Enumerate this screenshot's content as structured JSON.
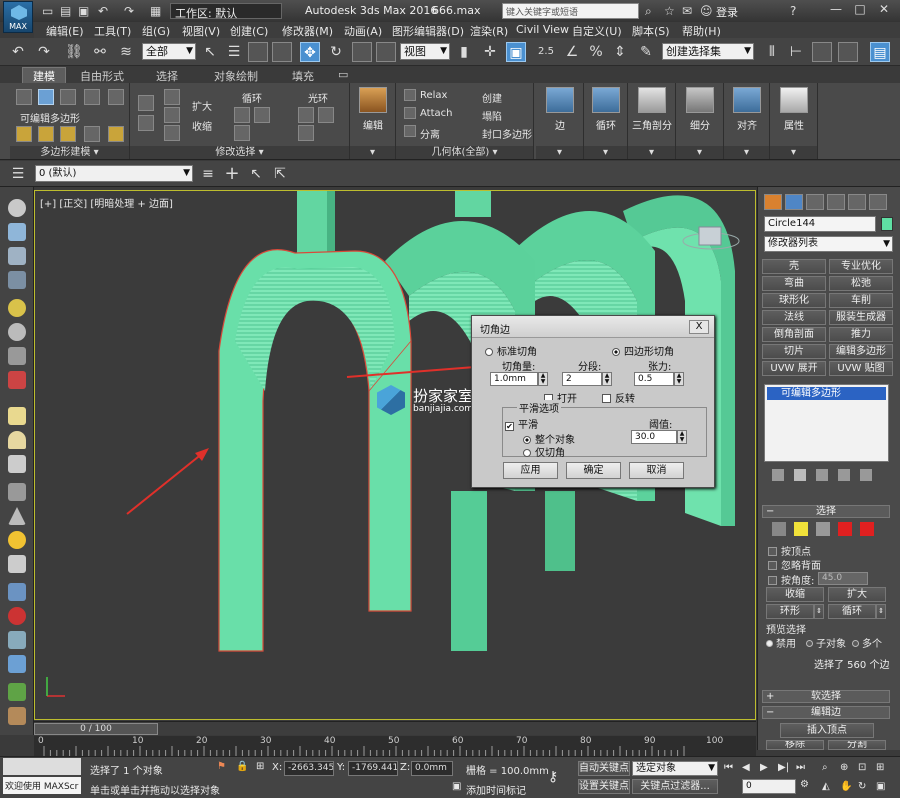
{
  "titlebar": {
    "logo_text": "MAX",
    "workspace": "工作区: 默认",
    "app_title": "Autodesk 3ds Max 2016",
    "file_title": "666.max",
    "search_placeholder": "键入关键字或短语",
    "login": "登录"
  },
  "menu": [
    "编辑(E)",
    "工具(T)",
    "组(G)",
    "视图(V)",
    "创建(C)",
    "修改器(M)",
    "动画(A)",
    "图形编辑器(D)",
    "渲染(R)",
    "Civil View",
    "自定义(U)",
    "脚本(S)",
    "帮助(H)"
  ],
  "toolbar": {
    "filter": "全部",
    "view": "视图",
    "snap_angle": "2.5",
    "snap_percent": "%",
    "selection_set": "创建选择集"
  },
  "ribbon": {
    "tabs": [
      "建模",
      "自由形式",
      "选择",
      "对象绘制",
      "填充"
    ],
    "selected_tab": "建模",
    "panel_poly": "可编辑多边形",
    "panel_poly_footer": "多边形建模",
    "grow": "扩大",
    "shrink": "收缩",
    "loop": "循环",
    "ring": "光环",
    "modify_sel_footer": "修改选择",
    "edit": "编辑",
    "relax": "Relax",
    "create": "创建",
    "attach": "Attach",
    "collapse": "塌陷",
    "detach": "分离",
    "cap": "封口多边形",
    "geometry_footer": "几何体(全部)",
    "big_buttons": [
      "边",
      "循环",
      "三角剖分",
      "细分",
      "对齐",
      "属性"
    ]
  },
  "layer": {
    "current": "0 (默认)"
  },
  "viewport": {
    "label": "[+] [正交] [明暗处理 + 边面]"
  },
  "chamfer_dialog": {
    "title": "切角边",
    "close": "X",
    "standard_chamfer": "标准切角",
    "quad_chamfer": "四边形切角",
    "amount_label": "切角量:",
    "segments_label": "分段:",
    "tension_label": "张力:",
    "amount": "1.0mm",
    "segments": "2",
    "tension": "0.5",
    "open": "打开",
    "invert": "反转",
    "smooth_group_label": "平滑选项",
    "smooth": "平滑",
    "threshold_label": "阈值:",
    "threshold": "30.0",
    "whole_object": "整个对象",
    "chamfers_only": "仅切角",
    "apply": "应用",
    "ok": "确定",
    "cancel": "取消"
  },
  "watermark": {
    "name": "扮家家室内设计",
    "url": "banjiajia.com"
  },
  "command_panel": {
    "object_name": "Circle144",
    "object_color": "#5fe0a4",
    "modifier_list": "修改器列表",
    "modifier_buttons": [
      "壳",
      "专业优化",
      "弯曲",
      "松弛",
      "球形化",
      "车削",
      "法线",
      "服装生成器",
      "倒角剖面",
      "推力",
      "切片",
      "编辑多边形",
      "UVW 展开",
      "UVW 贴图"
    ],
    "stack_item": "可编辑多边形",
    "selection_rollout": "选择",
    "by_vertex": "按顶点",
    "ignore_backfacing": "忽略背面",
    "by_angle": "按角度:",
    "angle_value": "45.0",
    "shrink": "收缩",
    "grow": "扩大",
    "ring": "环形",
    "loop": "循环",
    "preview_label": "预览选择",
    "preview_disabled": "禁用",
    "preview_subobject": "子对象",
    "preview_multi": "多个",
    "selected_count": "选择了 560 个边",
    "soft_selection": "软选择",
    "edit_edges": "编辑边",
    "insert_vertex": "插入顶点",
    "remove": "移除",
    "split": "分割"
  },
  "timeline": {
    "frame": "0 / 100",
    "ticks": [
      "0",
      "10",
      "20",
      "30",
      "40",
      "50",
      "60",
      "70",
      "80",
      "90",
      "100"
    ]
  },
  "status": {
    "welcome": "欢迎使用 MAXScr",
    "selected": "选择了 1 个对象",
    "hint": "单击或单击并拖动以选择对象",
    "x_label": "X:",
    "x": "-2663.345",
    "y_label": "Y:",
    "y": "-1769.441",
    "z_label": "Z:",
    "z": "0.0mm",
    "grid": "栅格 = 100.0mm",
    "add_time_tag": "添加时间标记",
    "auto_key": "自动关键点",
    "selected_object": "选定对象",
    "set_key": "设置关键点",
    "key_filters": "关键点过滤器...",
    "frame_field": "0"
  }
}
